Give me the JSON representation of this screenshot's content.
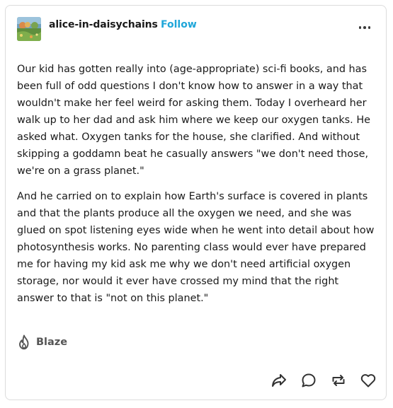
{
  "post": {
    "author": "alice-in-daisychains",
    "follow_label": "Follow",
    "paragraphs": [
      "Our kid has gotten really into (age-appropriate) sci-fi books, and has been full of odd questions I don't know how to answer in a way that wouldn't make her feel weird for asking them. Today I overheard her walk up to her dad and ask him where we keep our oxygen tanks. He asked what. Oxygen tanks for the house, she clarified. And without skipping a goddamn beat he casually answers \"we don't need those, we're on a grass planet.\"",
      "And he carried on to explain how Earth's surface is covered in plants and that the plants produce all the oxygen we need, and she was glued on spot listening eyes wide when he went into detail about how photosynthesis works. No parenting class would ever have prepared me for having my kid ask me why we don't need artificial oxygen storage, nor would it ever have crossed my mind that the right answer to that is \"not on this planet.\""
    ]
  },
  "footer": {
    "blaze_label": "Blaze"
  },
  "icons": {
    "avatar": "avatar-landscape",
    "more": "more-options-icon",
    "blaze": "flame-icon",
    "share": "share-icon",
    "reply": "reply-icon",
    "reblog": "reblog-icon",
    "like": "heart-icon"
  },
  "colors": {
    "follow": "#1fa6d9",
    "text": "#1a1a1a",
    "muted": "#555555",
    "border": "#dcdcdc"
  }
}
